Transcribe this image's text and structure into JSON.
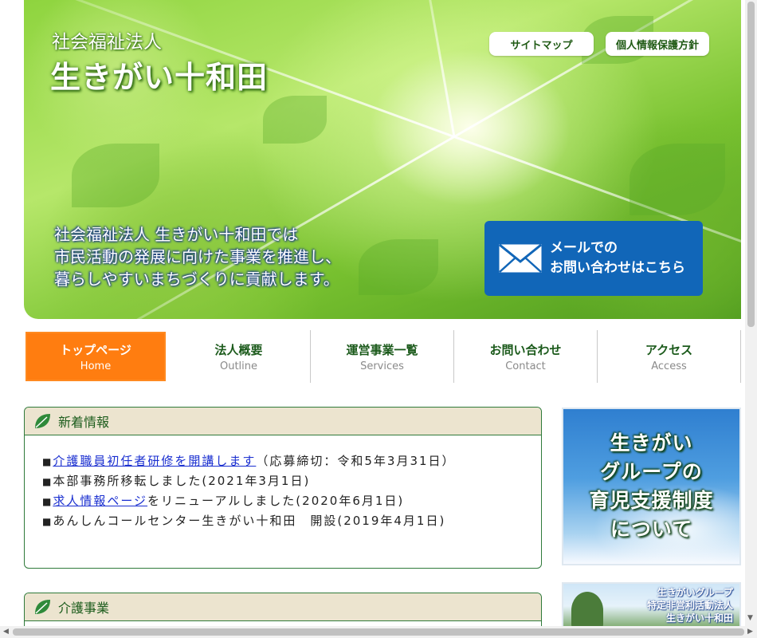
{
  "header": {
    "org_type": "社会福祉法人",
    "org_name": "生きがい十和田",
    "links": {
      "sitemap": "サイトマップ",
      "privacy": "個人情報保護方針"
    },
    "tagline": [
      "社会福祉法人 生きがい十和田では",
      "市民活動の発展に向けた事業を推進し、",
      "暮らしやすいまちづくりに貢献します。"
    ],
    "mail_button": [
      "メールでの",
      "お問い合わせはこちら"
    ],
    "icons": {
      "mail": "envelope-icon"
    }
  },
  "nav": {
    "items": [
      {
        "jp": "トップページ",
        "en": "Home",
        "active": true
      },
      {
        "jp": "法人概要",
        "en": "Outline"
      },
      {
        "jp": "運営事業一覧",
        "en": "Services"
      },
      {
        "jp": "お問い合わせ",
        "en": "Contact"
      },
      {
        "jp": "アクセス",
        "en": "Access"
      }
    ]
  },
  "news": {
    "title": "新着情報",
    "bullet": "■",
    "items": [
      {
        "link": "介護職員初任者研修を開講します",
        "text": "（応募締切：令和5年3月31日）"
      },
      {
        "text": "本部事務所移転しました(2021年3月1日)"
      },
      {
        "link": "求人情報ページ",
        "text": "をリニューアルしました(2020年6月1日)"
      },
      {
        "text": "あんしんコールセンター生きがい十和田　開設(2019年4月1日)"
      }
    ]
  },
  "care": {
    "title": "介護事業"
  },
  "side": {
    "banner1": [
      "生きがい",
      "グループの",
      "育児支援制度",
      "について"
    ],
    "banner2": [
      "生きがいグループ",
      "特定非営利活動法人",
      "生きがい十和田"
    ]
  },
  "colors": {
    "nav_active": "#ff7d10",
    "mail_button": "#1166b8",
    "panel_border": "#2f7a3a",
    "panel_head": "#ece4cf",
    "link": "#1a2fd0"
  }
}
